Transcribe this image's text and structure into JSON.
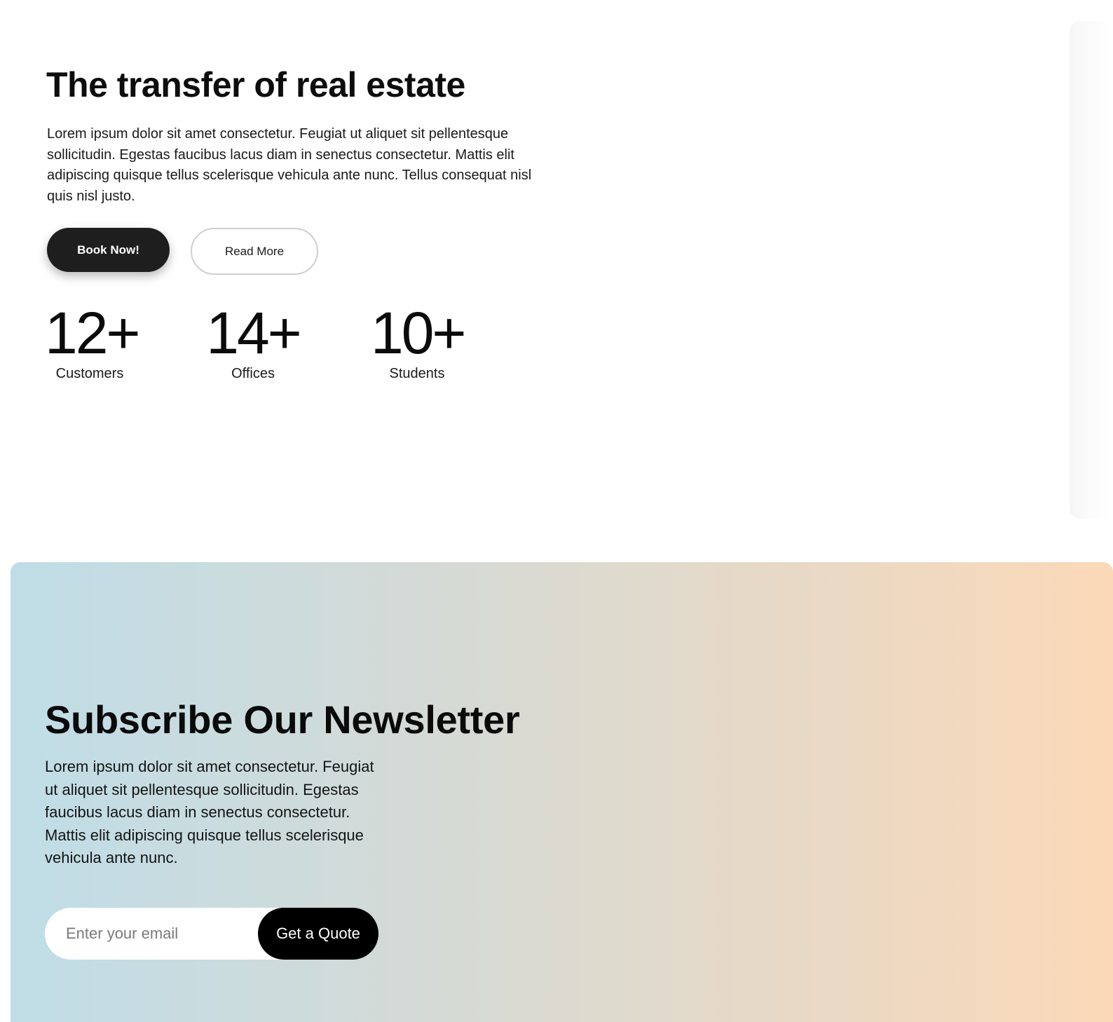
{
  "hero": {
    "title": "The transfer of real estate",
    "description": "Lorem ipsum dolor sit amet consectetur. Feugiat ut aliquet sit pellentesque sollicitudin. Egestas faucibus lacus diam in senectus consectetur. Mattis elit adipiscing quisque tellus scelerisque vehicula ante nunc. Tellus consequat nisl quis nisl justo.",
    "book_button": "Book Now!",
    "read_button": "Read More",
    "stats": [
      {
        "value": "12+",
        "label": "Customers"
      },
      {
        "value": "14+",
        "label": "Offices"
      },
      {
        "value": "10+",
        "label": "Students"
      }
    ]
  },
  "newsletter": {
    "title": "Subscribe Our Newsletter",
    "description": "Lorem ipsum dolor sit amet consectetur. Feugiat ut aliquet sit pellentesque sollicitudin. Egestas faucibus lacus diam in senectus consectetur. Mattis elit adipiscing quisque tellus scelerisque vehicula ante nunc.",
    "email_placeholder": "Enter your email",
    "submit_button": "Get a Quote"
  },
  "colors": {
    "primary_button": "#1e1e1e",
    "quote_button": "#000000",
    "gradient_start": "#bfdde7",
    "gradient_end": "#fbd9b8"
  }
}
